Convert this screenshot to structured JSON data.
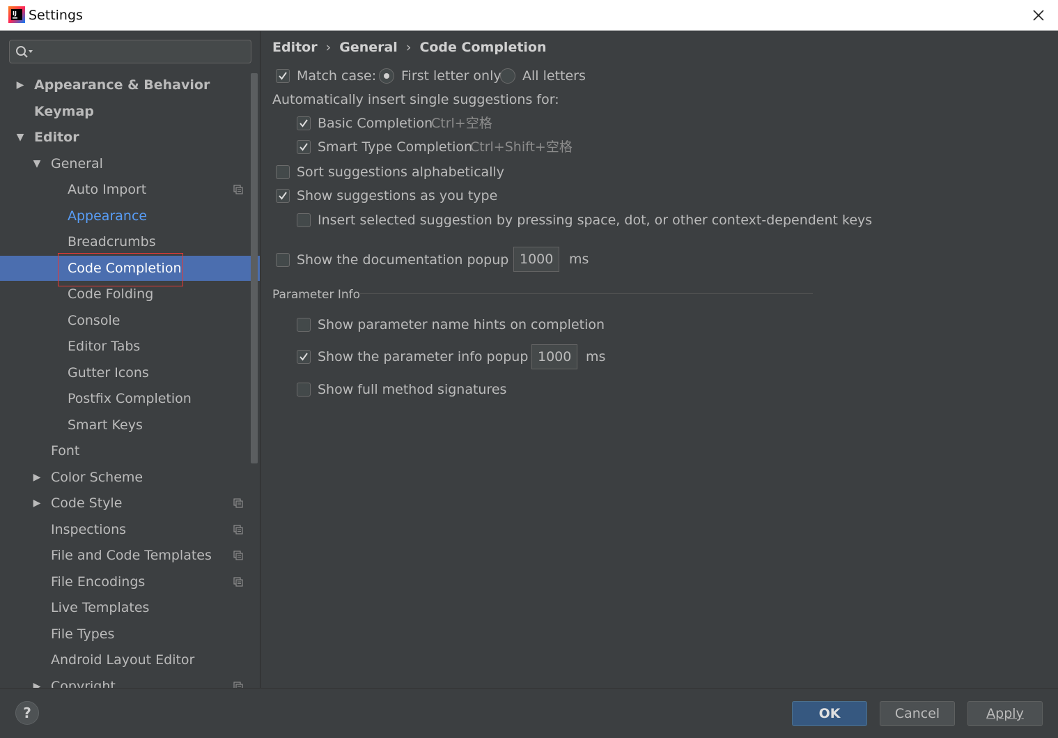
{
  "window": {
    "title": "Settings"
  },
  "search": {
    "placeholder": ""
  },
  "sidebar": {
    "items": [
      {
        "label": "Appearance & Behavior",
        "level": 0,
        "arrow": "right",
        "bold": true
      },
      {
        "label": "Keymap",
        "level": 0,
        "arrow": "none",
        "bold": true
      },
      {
        "label": "Editor",
        "level": 0,
        "arrow": "down",
        "bold": true
      },
      {
        "label": "General",
        "level": 1,
        "arrow": "down"
      },
      {
        "label": "Auto Import",
        "level": 2,
        "arrow": "none",
        "copy_icon": true
      },
      {
        "label": "Appearance",
        "level": 2,
        "arrow": "none",
        "link": true
      },
      {
        "label": "Breadcrumbs",
        "level": 2,
        "arrow": "none"
      },
      {
        "label": "Code Completion",
        "level": 2,
        "arrow": "none",
        "selected": true
      },
      {
        "label": "Code Folding",
        "level": 2,
        "arrow": "none"
      },
      {
        "label": "Console",
        "level": 2,
        "arrow": "none"
      },
      {
        "label": "Editor Tabs",
        "level": 2,
        "arrow": "none"
      },
      {
        "label": "Gutter Icons",
        "level": 2,
        "arrow": "none"
      },
      {
        "label": "Postfix Completion",
        "level": 2,
        "arrow": "none"
      },
      {
        "label": "Smart Keys",
        "level": 2,
        "arrow": "none"
      },
      {
        "label": "Font",
        "level": 1,
        "arrow": "none"
      },
      {
        "label": "Color Scheme",
        "level": 1,
        "arrow": "right"
      },
      {
        "label": "Code Style",
        "level": 1,
        "arrow": "right",
        "copy_icon": true
      },
      {
        "label": "Inspections",
        "level": 1,
        "arrow": "none",
        "copy_icon": true
      },
      {
        "label": "File and Code Templates",
        "level": 1,
        "arrow": "none",
        "copy_icon": true
      },
      {
        "label": "File Encodings",
        "level": 1,
        "arrow": "none",
        "copy_icon": true
      },
      {
        "label": "Live Templates",
        "level": 1,
        "arrow": "none"
      },
      {
        "label": "File Types",
        "level": 1,
        "arrow": "none"
      },
      {
        "label": "Android Layout Editor",
        "level": 1,
        "arrow": "none"
      },
      {
        "label": "Copyright",
        "level": 1,
        "arrow": "right",
        "copy_icon": true
      }
    ]
  },
  "breadcrumb": {
    "items": [
      "Editor",
      "General",
      "Code Completion"
    ],
    "separator": "›"
  },
  "options": {
    "match_case": {
      "label": "Match case:",
      "checked": true
    },
    "first_letter_only": {
      "label": "First letter only",
      "selected": true
    },
    "all_letters": {
      "label": "All letters",
      "selected": false
    },
    "auto_insert_heading": "Automatically insert single suggestions for:",
    "basic_completion": {
      "label": "Basic Completion",
      "shortcut": "Ctrl+空格",
      "checked": true
    },
    "smart_type_completion": {
      "label": "Smart Type Completion",
      "shortcut": "Ctrl+Shift+空格",
      "checked": true
    },
    "sort_alphabetically": {
      "label": "Sort suggestions alphabetically",
      "checked": false
    },
    "show_as_you_type": {
      "label": "Show suggestions as you type",
      "checked": true
    },
    "insert_selected": {
      "label": "Insert selected suggestion by pressing space, dot, or other context-dependent keys",
      "checked": false
    },
    "doc_popup": {
      "label": "Show the documentation popup in",
      "value": "1000",
      "unit": "ms",
      "checked": false
    }
  },
  "parameter_info": {
    "title": "Parameter Info",
    "name_hints": {
      "label": "Show parameter name hints on completion",
      "checked": false
    },
    "info_popup": {
      "label": "Show the parameter info popup in",
      "value": "1000",
      "unit": "ms",
      "checked": true
    },
    "full_signatures": {
      "label": "Show full method signatures",
      "checked": false
    }
  },
  "footer": {
    "help": "?",
    "ok": "OK",
    "cancel": "Cancel",
    "apply": "Apply"
  },
  "colors": {
    "background": "#3c3f41",
    "selection": "#4b6eaf",
    "link": "#589df6",
    "primary_button": "#365880",
    "highlight_box": "#e53935"
  }
}
